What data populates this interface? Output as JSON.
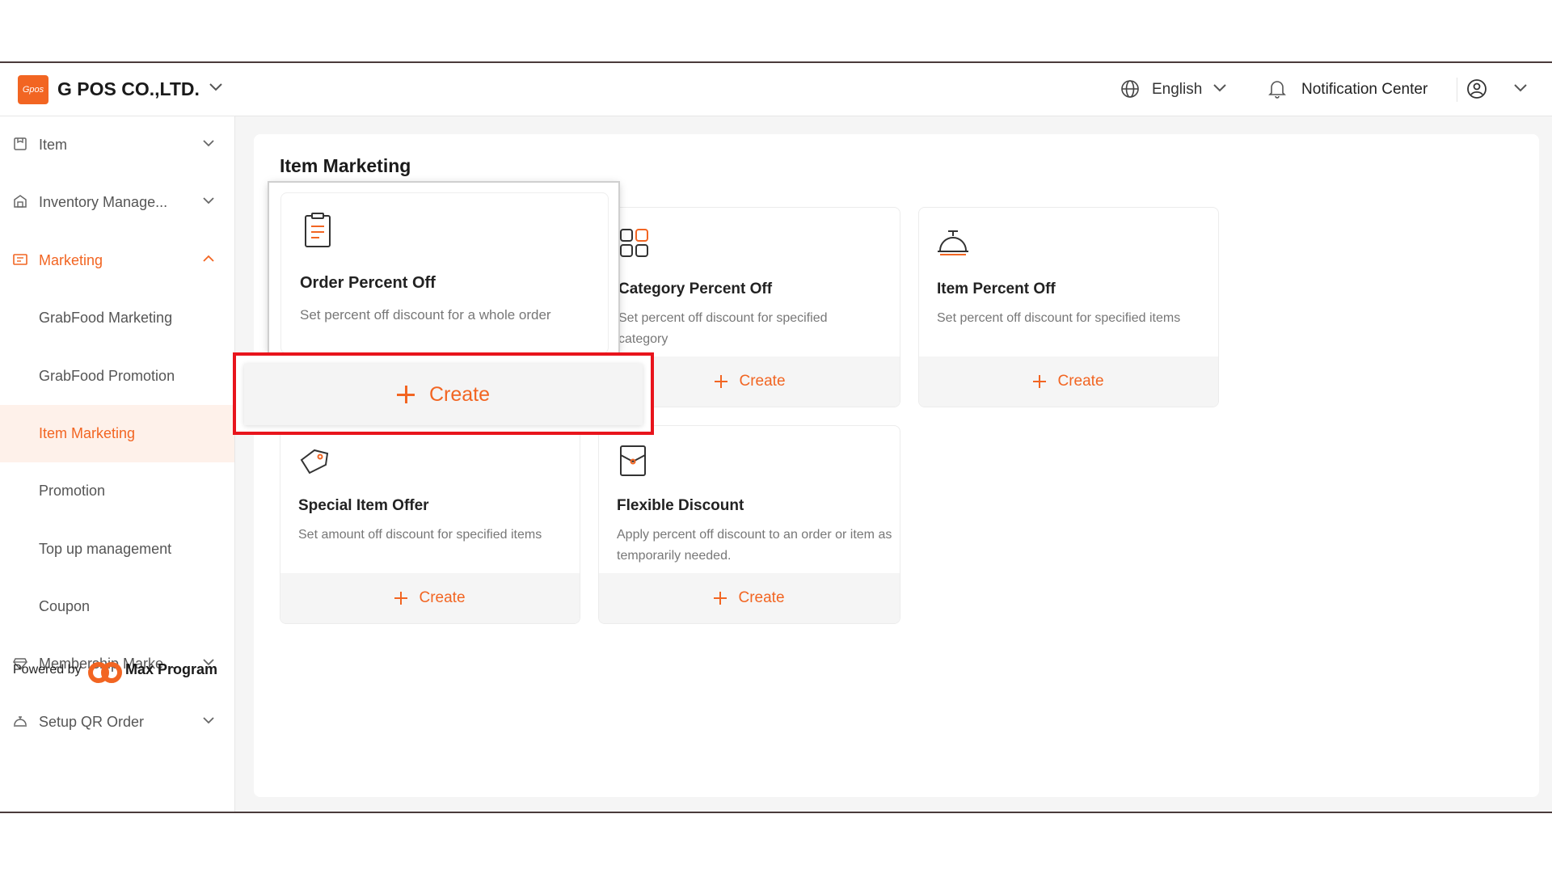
{
  "header": {
    "logo_text": "Gpos",
    "company": "G POS CO.,LTD.",
    "language": "English",
    "notification": "Notification Center"
  },
  "sidebar": {
    "items": [
      {
        "label": "Item",
        "icon": "item-icon"
      },
      {
        "label": "Inventory Manage...",
        "icon": "warehouse-icon"
      },
      {
        "label": "Marketing",
        "icon": "marketing-icon"
      },
      {
        "label": "GrabFood Marketing"
      },
      {
        "label": "GrabFood Promotion"
      },
      {
        "label": "Item Marketing"
      },
      {
        "label": "Promotion"
      },
      {
        "label": "Top up management"
      },
      {
        "label": "Coupon"
      },
      {
        "label": "Membership Marke...",
        "icon": "membership-icon"
      },
      {
        "label": "Setup QR Order",
        "icon": "qr-order-icon"
      }
    ],
    "powered_by": "Powered by",
    "brand": "Max Program"
  },
  "main": {
    "title": "Item Marketing",
    "cards": [
      {
        "title": "Order Percent Off",
        "desc": "Set percent off discount for a whole order",
        "action": "Create"
      },
      {
        "title": "Category Percent Off",
        "desc": "Set percent off discount for specified category",
        "action": "Create"
      },
      {
        "title": "Item Percent Off",
        "desc": "Set percent off discount for specified items",
        "action": "Create"
      },
      {
        "title": "Special Item Offer",
        "desc": "Set amount off discount for specified items",
        "action": "Create"
      },
      {
        "title": "Flexible Discount",
        "desc": "Apply percent off discount to an order or item as temporarily needed.",
        "action": "Create"
      }
    ]
  },
  "colors": {
    "accent": "#f26522",
    "highlight": "#e8141c"
  }
}
